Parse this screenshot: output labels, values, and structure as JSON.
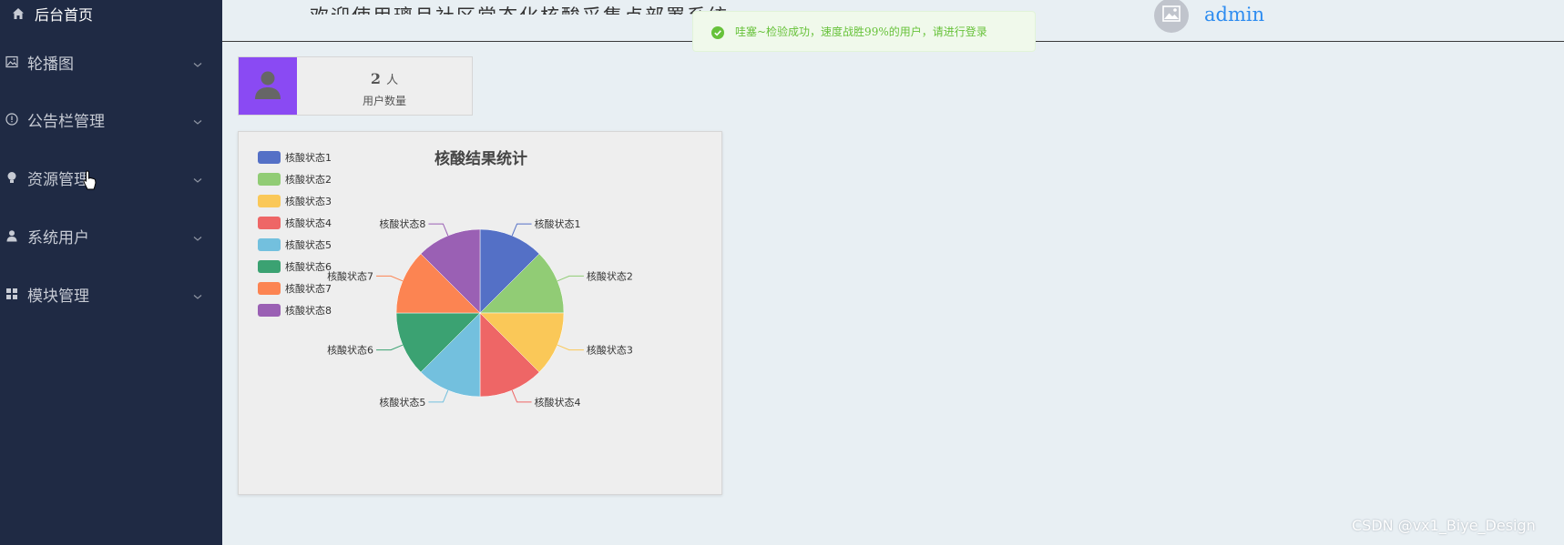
{
  "sidebar": {
    "home_label": "后台首页",
    "items": [
      {
        "label": "轮播图",
        "icon": "image-icon"
      },
      {
        "label": "公告栏管理",
        "icon": "info-icon"
      },
      {
        "label": "资源管理",
        "icon": "bulb-icon"
      },
      {
        "label": "系统用户",
        "icon": "user-icon"
      },
      {
        "label": "模块管理",
        "icon": "grid-icon"
      }
    ]
  },
  "header": {
    "title": "欢迎使用璃月社区常态化核酸采集点部署系统",
    "username": "admin"
  },
  "toast": {
    "message": "哇塞~检验成功，速度战胜99%的用户，请进行登录",
    "color": "#67c23a"
  },
  "user_card": {
    "count": "2",
    "unit": "人",
    "label": "用户数量",
    "accent": "#8a4af3"
  },
  "chart_data": {
    "type": "pie",
    "title": "核酸结果统计",
    "legend_position": "top-left",
    "categories": [
      "核酸状态1",
      "核酸状态2",
      "核酸状态3",
      "核酸状态4",
      "核酸状态5",
      "核酸状态6",
      "核酸状态7",
      "核酸状态8"
    ],
    "values": [
      1,
      1,
      1,
      1,
      1,
      1,
      1,
      1
    ],
    "colors": [
      "#5470c6",
      "#91cc75",
      "#fac858",
      "#ee6666",
      "#73c0de",
      "#3ba272",
      "#fc8452",
      "#9a60b4"
    ]
  },
  "watermark": "CSDN @vx1_Biye_Design"
}
